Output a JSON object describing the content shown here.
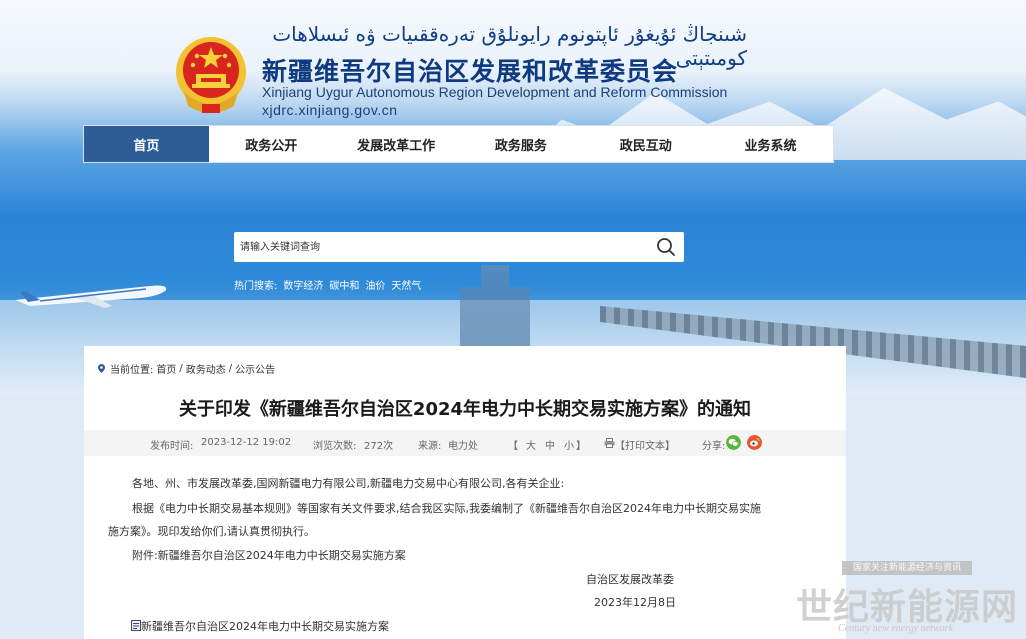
{
  "header": {
    "title_uyghur": "شىنجاڭ ئۇيغۇر ئاپتونوم رايونلۇق تەرەققىيات ۋە ئىسلاھات كومىتېتى",
    "title_cn": "新疆维吾尔自治区发展和改革委员会",
    "title_en": "Xinjiang Uygur Autonomous Region Development and Reform Commission",
    "url": "xjdrc.xinjiang.gov.cn"
  },
  "nav": {
    "items": [
      {
        "label": "首页"
      },
      {
        "label": "政务公开"
      },
      {
        "label": "发展改革工作"
      },
      {
        "label": "政务服务"
      },
      {
        "label": "政民互动"
      },
      {
        "label": "业务系统"
      }
    ]
  },
  "search": {
    "placeholder": "请输入关键词查询",
    "hot_label": "热门搜索:",
    "hot_terms": [
      "数字经济",
      "碳中和",
      "油价",
      "天然气"
    ]
  },
  "breadcrumb": {
    "label": "当前位置:",
    "items": [
      "首页",
      "政务动态",
      "公示公告"
    ],
    "separator": "/"
  },
  "article": {
    "title": "关于印发《新疆维吾尔自治区2024年电力中长期交易实施方案》的通知",
    "meta": {
      "publish_label": "发布时间:",
      "publish_time": "2023-12-12 19:02",
      "views_label": "浏览次数:",
      "views": "272次",
      "source_label": "来源:",
      "source": "电力处",
      "font_open": "【",
      "font_large": "大",
      "font_medium": "中",
      "font_small": "小",
      "font_close": "】",
      "print_label": "【打印文本】",
      "share_label": "分享:"
    },
    "recipients": "各地、州、市发展改革委,国网新疆电力有限公司,新疆电力交易中心有限公司,各有关企业:",
    "body_line1": "根据《电力中长期交易基本规则》等国家有关文件要求,结合我区实际,我委编制了《新疆维吾尔自治区2024年电力中长期交易实施",
    "body_line2": "施方案》。现印发给你们,请认真贯彻执行。",
    "attachment_line": "附件:新疆维吾尔自治区2024年电力中长期交易实施方案",
    "signature": "自治区发展改革委",
    "date": "2023年12月8日",
    "attachment_file": "新疆维吾尔自治区2024年电力中长期交易实施方案"
  },
  "watermark": {
    "top": "国家关注新能源经济与资讯",
    "main": "世纪新能源网",
    "en": "Century new energy network"
  },
  "colors": {
    "nav_active": "#2e5d96",
    "title_blue": "#0e3a82",
    "wechat": "#5bb53a",
    "weibo": "#e8542f"
  }
}
